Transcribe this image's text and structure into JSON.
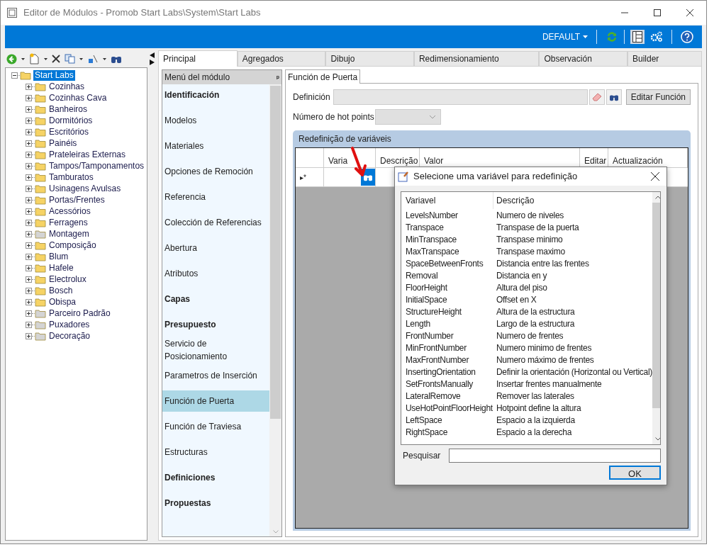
{
  "window": {
    "title": "Editor de Módulos - Promob Start Labs\\System\\Start Labs"
  },
  "header_bar": {
    "profile": "DEFAULT",
    "layout_selected": true
  },
  "tree": {
    "label": "Start Labs",
    "expanded": true,
    "selected": true,
    "children": [
      {
        "label": "Cozinhas",
        "expanded": false,
        "color": "#f6d365"
      },
      {
        "label": "Cozinhas Cava",
        "expanded": false,
        "color": "#f6d365"
      },
      {
        "label": "Banheiros",
        "expanded": false,
        "color": "#f6d365"
      },
      {
        "label": "Dormitórios",
        "expanded": false,
        "color": "#f6d365"
      },
      {
        "label": "Escritórios",
        "expanded": false,
        "color": "#f6d365"
      },
      {
        "label": "Painéis",
        "expanded": false,
        "color": "#f6d365"
      },
      {
        "label": "Prateleiras Externas",
        "expanded": false,
        "color": "#f6d365"
      },
      {
        "label": "Tampos/Tamponamentos",
        "expanded": false,
        "color": "#f6d365"
      },
      {
        "label": "Tamburatos",
        "expanded": false,
        "color": "#f6d365"
      },
      {
        "label": "Usinagens Avulsas",
        "expanded": false,
        "color": "#f6d365"
      },
      {
        "label": "Portas/Frentes",
        "expanded": false,
        "color": "#f6d365"
      },
      {
        "label": "Acessórios",
        "expanded": false,
        "color": "#f6d365"
      },
      {
        "label": "Ferragens",
        "expanded": false,
        "color": "#f6d365"
      },
      {
        "label": "Montagem",
        "expanded": false,
        "color": "#d4d4d4"
      },
      {
        "label": "Composição",
        "expanded": false,
        "color": "#f6d365"
      },
      {
        "label": "Blum",
        "expanded": false,
        "color": "#f6d365"
      },
      {
        "label": "Hafele",
        "expanded": false,
        "color": "#f6d365"
      },
      {
        "label": "Electrolux",
        "expanded": false,
        "color": "#f6d365"
      },
      {
        "label": "Bosch",
        "expanded": false,
        "color": "#f6d365"
      },
      {
        "label": "Obispa",
        "expanded": false,
        "color": "#f6d365"
      },
      {
        "label": "Parceiro Padrão",
        "expanded": false,
        "color": "#d4d4d4"
      },
      {
        "label": "Puxadores",
        "expanded": false,
        "color": "#d4d4d4"
      },
      {
        "label": "Decoração",
        "expanded": false,
        "color": "#d4d4d4"
      }
    ]
  },
  "tabs": [
    {
      "label": "Principal",
      "selected": true
    },
    {
      "label": "Agregados",
      "selected": false
    },
    {
      "label": "Dibujo",
      "selected": false
    },
    {
      "label": "Redimensionamiento",
      "selected": false
    },
    {
      "label": "Observación",
      "selected": false
    },
    {
      "label": "Builder",
      "selected": false
    }
  ],
  "module_menu": {
    "title": "Menú del módulo",
    "pin": "ᵖ",
    "items": [
      {
        "label": "Identificación",
        "kind": "group",
        "selected": false
      },
      {
        "label": "Modelos",
        "kind": "item",
        "selected": false
      },
      {
        "label": "Materiales",
        "kind": "item",
        "selected": false
      },
      {
        "label": "Opciones de Remoción",
        "kind": "item",
        "selected": false
      },
      {
        "label": "Referencia",
        "kind": "item",
        "selected": false
      },
      {
        "label": "Colección de Referencias",
        "kind": "item",
        "selected": false
      },
      {
        "label": "Abertura",
        "kind": "item",
        "selected": false
      },
      {
        "label": "Atributos",
        "kind": "item",
        "selected": false
      },
      {
        "label": "Capas",
        "kind": "group",
        "selected": false
      },
      {
        "label": "Presupuesto",
        "kind": "group",
        "selected": false
      },
      {
        "label": "Servicio de Posicionamiento",
        "kind": "item",
        "selected": false
      },
      {
        "label": "Parametros de Inserción",
        "kind": "item",
        "selected": false
      },
      {
        "label": "Función de Puerta",
        "kind": "item",
        "selected": true
      },
      {
        "label": "Función de Traviesa",
        "kind": "item",
        "selected": false
      },
      {
        "label": "Estructuras",
        "kind": "item",
        "selected": false
      },
      {
        "label": "Definiciones",
        "kind": "group",
        "selected": false
      },
      {
        "label": "Propuestas",
        "kind": "group",
        "selected": false
      }
    ]
  },
  "panel": {
    "tab": "Función de Puerta",
    "definition_label": "Definición",
    "edit_button": "Editar Función",
    "hotpoints_label": "Número de hot points",
    "grid_title": "Redefinição de variáveis",
    "columns": [
      "Varia",
      "Descrição",
      "Valor",
      "Editar",
      "Actualización"
    ],
    "row_marker": "▸*"
  },
  "dialog": {
    "title": "Selecione uma variável para redefinição",
    "columns": [
      "Variavel",
      "Descrição"
    ],
    "rows": [
      [
        "LevelsNumber",
        "Numero de niveles"
      ],
      [
        "Transpace",
        "Transpase de la puerta"
      ],
      [
        "MinTranspace",
        "Transpase minimo"
      ],
      [
        "MaxTranspace",
        "Transpase maximo"
      ],
      [
        "SpaceBetweenFronts",
        "Distancia entre las frentes"
      ],
      [
        "Removal",
        "Distancia en y"
      ],
      [
        "FloorHeight",
        "Altura del piso"
      ],
      [
        "InitialSpace",
        "Offset en X"
      ],
      [
        "StructureHeight",
        "Altura de la estructura"
      ],
      [
        "Length",
        "Largo de la estructura"
      ],
      [
        "FrontNumber",
        "Numero de frentes"
      ],
      [
        "MinFrontNumber",
        "Numero minimo de frentes"
      ],
      [
        "MaxFrontNumber",
        "Numero máximo de frentes"
      ],
      [
        "InsertingOrientation",
        "Definir la orientación (Horizontal ou Vertical)"
      ],
      [
        "SetFrontsManually",
        "Insertar frentes manualmente"
      ],
      [
        "LateralRemove",
        "Remover las laterales"
      ],
      [
        "UseHotPointFloorHeight",
        "Hotpoint define la altura"
      ],
      [
        "LeftSpace",
        "Espacio a la izquierda"
      ],
      [
        "RightSpace",
        "Espacio a la derecha"
      ]
    ],
    "search_label": "Pesquisar",
    "ok": "OK"
  }
}
